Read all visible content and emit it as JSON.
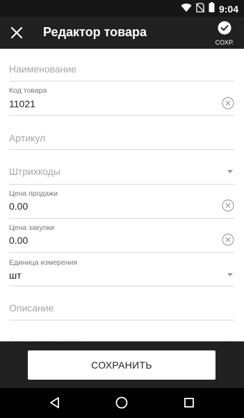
{
  "status_bar": {
    "time": "9:04"
  },
  "app_bar": {
    "title": "Редактор товара",
    "save_action_label": "СОХР."
  },
  "form": {
    "name": {
      "placeholder": "Наименование"
    },
    "product_code": {
      "label": "Код товара",
      "value": "11021"
    },
    "sku": {
      "placeholder": "Артикул"
    },
    "barcodes": {
      "placeholder": "Штрихкоды"
    },
    "sale_price": {
      "label": "Цена продажи",
      "value": "0.00"
    },
    "purchase_price": {
      "label": "Цена закупки",
      "value": "0.00"
    },
    "unit": {
      "label": "Единица измерения",
      "value": "шт"
    },
    "description": {
      "placeholder": "Описание"
    },
    "product_group": {
      "placeholder": "Товарная группа"
    }
  },
  "bottom": {
    "save_button_label": "СОХРАНИТЬ"
  },
  "colors": {
    "app_bar_bg": "#212121",
    "status_bar_bg": "#161616",
    "nav_bar_bg": "#000000",
    "divider": "#d9d9d9",
    "placeholder_text": "#a6a6a6"
  },
  "icons": {
    "status": [
      "wifi-icon",
      "no-sim-icon",
      "battery-icon"
    ],
    "app_bar": [
      "close-icon",
      "checkmark-icon"
    ],
    "fields": [
      "clear-icon",
      "dropdown-arrow-icon"
    ],
    "nav": [
      "back-icon",
      "home-icon",
      "recents-icon"
    ]
  }
}
